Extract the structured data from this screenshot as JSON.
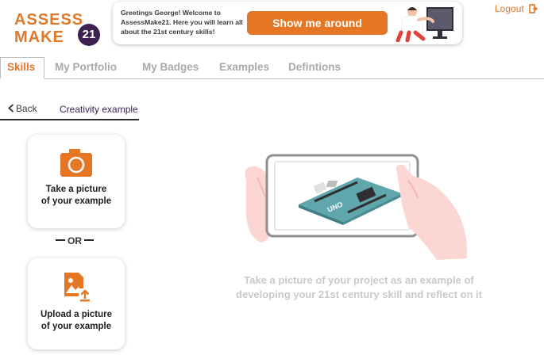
{
  "app": {
    "logo_line1": "ASSESS",
    "logo_line2": "MAKE",
    "logo_number": "21",
    "brand_color": "#e57624",
    "brand_dark": "#3d2251"
  },
  "banner": {
    "greeting": "Greetings George! Welcome to AssessMake21. Here you will learn all about the 21st century skills!",
    "tour_button_label": "Show me around"
  },
  "header": {
    "logout_label": "Logout",
    "logout_icon": "logout-icon"
  },
  "tabs": [
    {
      "label": "Skills",
      "active": true
    },
    {
      "label": "My Portfolio",
      "active": false
    },
    {
      "label": "My Badges",
      "active": false
    },
    {
      "label": "Examples",
      "active": false
    },
    {
      "label": "Defintions",
      "active": false
    }
  ],
  "subheader": {
    "back_label": "Back",
    "title": "Creativity example"
  },
  "options": {
    "take_picture": {
      "icon": "camera-icon",
      "line1": "Take a picture",
      "line2": "of your example"
    },
    "separator": "OR",
    "upload_picture": {
      "icon": "image-upload-icon",
      "line1": "Upload a picture",
      "line2": "of your example"
    }
  },
  "main": {
    "illustration_icon": "tablet-photo-illustration",
    "board_label": "UNO",
    "hint_line1": "Take a picture  of your project as an example of",
    "hint_line2": "developing your 21st century skill and reflect on it"
  }
}
